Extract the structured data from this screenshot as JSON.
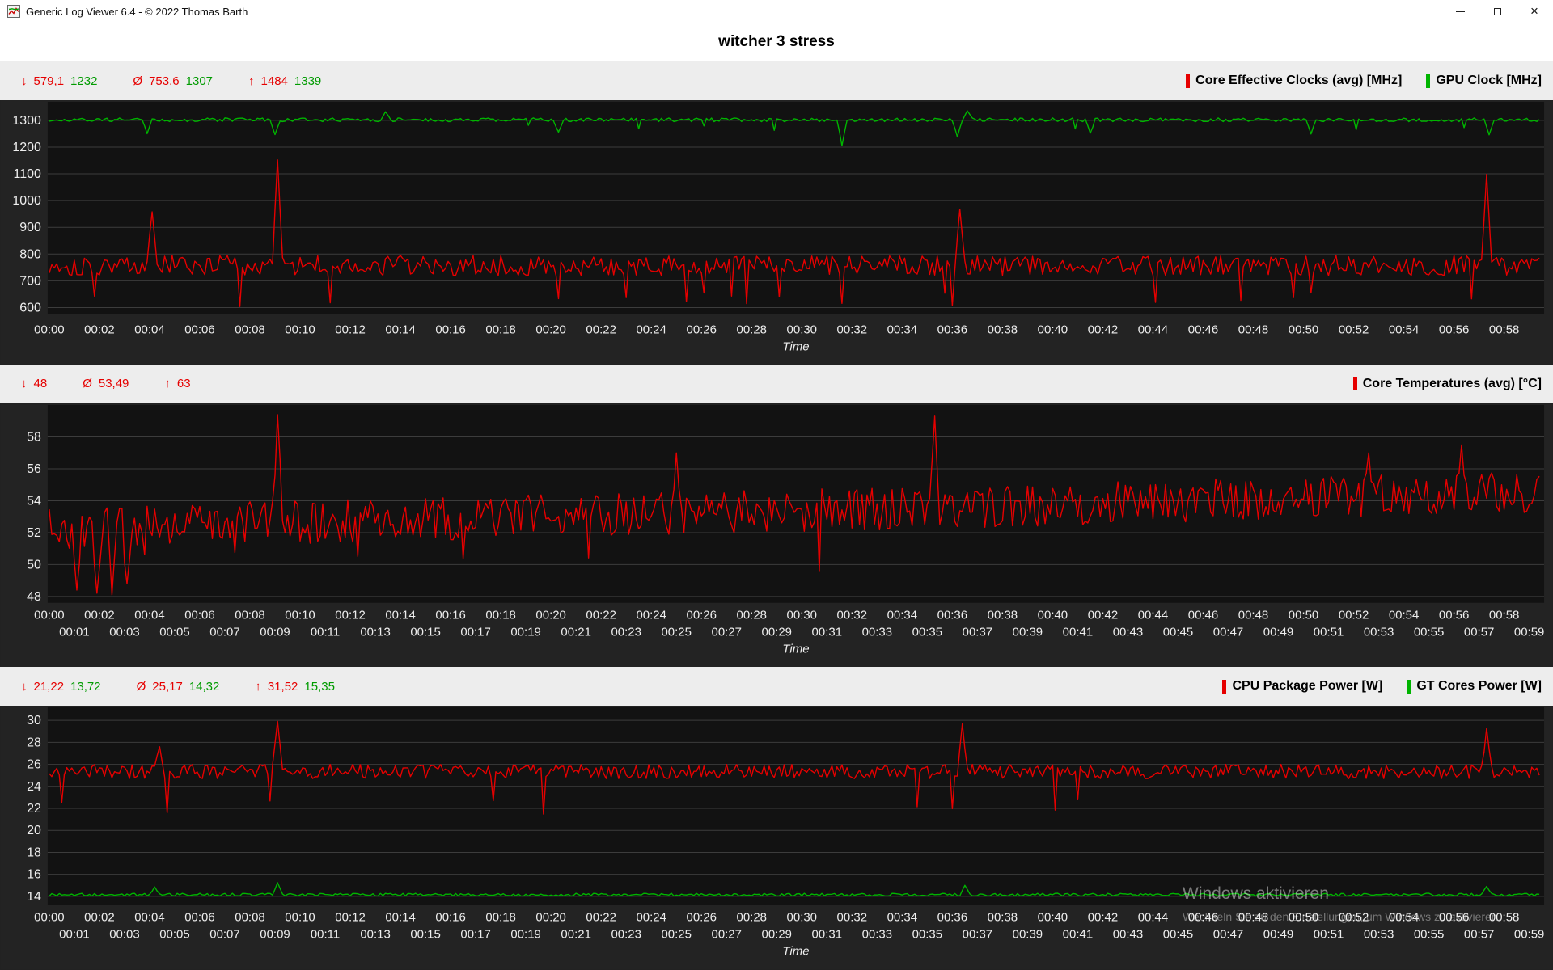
{
  "window": {
    "title": "Generic Log Viewer 6.4 - © 2022 Thomas Barth",
    "buttons": {
      "minimize": "minimize",
      "restore": "restore",
      "close": "×"
    }
  },
  "page": {
    "title": "witcher 3 stress"
  },
  "colors": {
    "red": "#e60000",
    "green": "#00b400",
    "green_text": "#009b00",
    "axis_text": "#eeeeee",
    "grid": "#3c3c3c",
    "band_bg": "#232323",
    "plot_bg": "#121212",
    "panel_bg": "#ededed"
  },
  "watermark": {
    "line1": "Windows aktivieren",
    "line2": "Wechseln Sie zu den Einstellungen, um Windows zu aktivieren."
  },
  "sections": [
    {
      "stats": [
        {
          "sym": "↓",
          "red": "579,1",
          "green": "1232"
        },
        {
          "sym": "Ø",
          "red": "753,6",
          "green": "1307"
        },
        {
          "sym": "↑",
          "red": "1484",
          "green": "1339"
        }
      ],
      "legend": [
        {
          "color": "#e60000",
          "label": "Core Effective Clocks (avg) [MHz]"
        },
        {
          "color": "#00b400",
          "label": "GPU Clock [MHz]"
        }
      ]
    },
    {
      "stats": [
        {
          "sym": "↓",
          "red": "48"
        },
        {
          "sym": "Ø",
          "red": "53,49"
        },
        {
          "sym": "↑",
          "red": "63"
        }
      ],
      "legend": [
        {
          "color": "#e60000",
          "label": "Core Temperatures (avg) [°C]"
        }
      ]
    },
    {
      "stats": [
        {
          "sym": "↓",
          "red": "21,22",
          "green": "13,72"
        },
        {
          "sym": "Ø",
          "red": "25,17",
          "green": "14,32"
        },
        {
          "sym": "↑",
          "red": "31,52",
          "green": "15,35"
        }
      ],
      "legend": [
        {
          "color": "#e60000",
          "label": "CPU Package Power [W]"
        },
        {
          "color": "#00b400",
          "label": "GT Cores Power [W]"
        }
      ]
    }
  ],
  "chart_data": [
    {
      "type": "line",
      "title": "Core Effective Clocks / GPU Clock",
      "xlabel": "Time",
      "x_domain_minutes": [
        0,
        59.4
      ],
      "y_domain": [
        575,
        1345
      ],
      "y_ticks": [
        1300,
        1200,
        1100,
        1000,
        900,
        800,
        700,
        600
      ],
      "x_ticks_row1": [
        "00:00",
        "00:02",
        "00:04",
        "00:06",
        "00:08",
        "00:10",
        "00:12",
        "00:14",
        "00:16",
        "00:18",
        "00:20",
        "00:22",
        "00:24",
        "00:26",
        "00:28",
        "00:30",
        "00:32",
        "00:34",
        "00:36",
        "00:38",
        "00:40",
        "00:42",
        "00:44",
        "00:46",
        "00:48",
        "00:50",
        "00:52",
        "00:54",
        "00:56",
        "00:58"
      ],
      "x_ticks_row2": null,
      "stats": {
        "min": [
          579.1,
          1232
        ],
        "avg": [
          753.6,
          1307
        ],
        "max": [
          1484,
          1339
        ]
      },
      "series": [
        {
          "name": "Core Effective Clocks (avg) [MHz]",
          "color": "#e60000",
          "seed": 101,
          "base": 757,
          "noise": 38,
          "trend": 0,
          "dip": {
            "prob": 0.035,
            "low": 598,
            "high": 668
          },
          "events": [
            {
              "min": 4.1,
              "value": 958
            },
            {
              "min": 9.05,
              "value": 1152
            },
            {
              "min": 36.3,
              "value": 968
            },
            {
              "min": 57.3,
              "value": 1098
            }
          ]
        },
        {
          "name": "GPU Clock [MHz]",
          "color": "#00b400",
          "seed": 202,
          "base": 1302,
          "noise": 7,
          "trend": 0,
          "dip": {
            "prob": 0.008,
            "low": 1262,
            "high": 1284
          },
          "events": [
            {
              "min": 3.9,
              "value": 1250
            },
            {
              "min": 9.0,
              "value": 1247
            },
            {
              "min": 13.4,
              "value": 1332
            },
            {
              "min": 20.3,
              "value": 1256
            },
            {
              "min": 31.6,
              "value": 1205
            },
            {
              "min": 36.2,
              "value": 1238
            },
            {
              "min": 36.6,
              "value": 1338
            },
            {
              "min": 41.5,
              "value": 1252
            },
            {
              "min": 50.3,
              "value": 1249
            },
            {
              "min": 57.4,
              "value": 1246
            }
          ]
        }
      ]
    },
    {
      "type": "line",
      "title": "Core Temperatures",
      "xlabel": "Time",
      "x_domain_minutes": [
        0,
        59.4
      ],
      "y_domain": [
        47.6,
        59.6
      ],
      "y_ticks": [
        58,
        56,
        54,
        52,
        50,
        48
      ],
      "x_ticks_row1": [
        "00:00",
        "00:02",
        "00:04",
        "00:06",
        "00:08",
        "00:10",
        "00:12",
        "00:14",
        "00:16",
        "00:18",
        "00:20",
        "00:22",
        "00:24",
        "00:26",
        "00:28",
        "00:30",
        "00:32",
        "00:34",
        "00:36",
        "00:38",
        "00:40",
        "00:42",
        "00:44",
        "00:46",
        "00:48",
        "00:50",
        "00:52",
        "00:54",
        "00:56",
        "00:58"
      ],
      "x_ticks_row2": [
        "00:01",
        "00:03",
        "00:05",
        "00:07",
        "00:09",
        "00:11",
        "00:13",
        "00:15",
        "00:17",
        "00:19",
        "00:21",
        "00:23",
        "00:25",
        "00:27",
        "00:29",
        "00:31",
        "00:33",
        "00:35",
        "00:37",
        "00:39",
        "00:41",
        "00:43",
        "00:45",
        "00:47",
        "00:49",
        "00:51",
        "00:53",
        "00:55",
        "00:57",
        "00:59"
      ],
      "stats": {
        "min": [
          48
        ],
        "avg": [
          53.49
        ],
        "max": [
          63
        ]
      },
      "series": [
        {
          "name": "Core Temperatures (avg) [°C]",
          "color": "#e60000",
          "seed": 303,
          "base": 52.3,
          "noise": 1.35,
          "trend": 2.2,
          "dip": {
            "prob": 0.012,
            "low": 49.4,
            "high": 51.0
          },
          "events": [
            {
              "min": 1.1,
              "value": 48.4
            },
            {
              "min": 1.9,
              "value": 48.2
            },
            {
              "min": 2.5,
              "value": 48.1
            },
            {
              "min": 3.1,
              "value": 48.8
            },
            {
              "min": 9.05,
              "value": 59.4
            },
            {
              "min": 25.0,
              "value": 57.0
            },
            {
              "min": 35.3,
              "value": 59.3
            },
            {
              "min": 52.6,
              "value": 57.0
            },
            {
              "min": 56.3,
              "value": 57.5
            }
          ]
        }
      ]
    },
    {
      "type": "line",
      "title": "CPU Package Power / GT Cores Power",
      "xlabel": "Time",
      "x_domain_minutes": [
        0,
        59.4
      ],
      "y_domain": [
        13.2,
        30.6
      ],
      "y_ticks": [
        30,
        28,
        26,
        24,
        22,
        20,
        18,
        16,
        14
      ],
      "x_ticks_row1": [
        "00:00",
        "00:02",
        "00:04",
        "00:06",
        "00:08",
        "00:10",
        "00:12",
        "00:14",
        "00:16",
        "00:18",
        "00:20",
        "00:22",
        "00:24",
        "00:26",
        "00:28",
        "00:30",
        "00:32",
        "00:34",
        "00:36",
        "00:38",
        "00:40",
        "00:42",
        "00:44",
        "00:46",
        "00:48",
        "00:50",
        "00:52",
        "00:54",
        "00:56",
        "00:58"
      ],
      "x_ticks_row2": [
        "00:01",
        "00:03",
        "00:05",
        "00:07",
        "00:09",
        "00:11",
        "00:13",
        "00:15",
        "00:17",
        "00:19",
        "00:21",
        "00:23",
        "00:25",
        "00:27",
        "00:29",
        "00:31",
        "00:33",
        "00:35",
        "00:37",
        "00:39",
        "00:41",
        "00:43",
        "00:45",
        "00:47",
        "00:49",
        "00:51",
        "00:53",
        "00:55",
        "00:57",
        "00:59"
      ],
      "stats": {
        "min": [
          21.22,
          13.72
        ],
        "avg": [
          25.17,
          14.32
        ],
        "max": [
          31.52,
          15.35
        ]
      },
      "series": [
        {
          "name": "CPU Package Power [W]",
          "color": "#e60000",
          "seed": 404,
          "base": 25.35,
          "noise": 0.65,
          "trend": 0,
          "dip": {
            "prob": 0.022,
            "low": 21.4,
            "high": 22.8
          },
          "events": [
            {
              "min": 4.35,
              "value": 27.6
            },
            {
              "min": 9.05,
              "value": 29.9
            },
            {
              "min": 36.4,
              "value": 29.7
            },
            {
              "min": 57.3,
              "value": 29.3
            }
          ]
        },
        {
          "name": "GT Cores Power [W]",
          "color": "#00b400",
          "seed": 505,
          "base": 14.15,
          "noise": 0.13,
          "trend": 0,
          "dip": null,
          "events": [
            {
              "min": 4.2,
              "value": 14.85
            },
            {
              "min": 9.05,
              "value": 15.25
            },
            {
              "min": 36.5,
              "value": 15.0
            },
            {
              "min": 57.3,
              "value": 14.9
            }
          ]
        }
      ]
    }
  ]
}
